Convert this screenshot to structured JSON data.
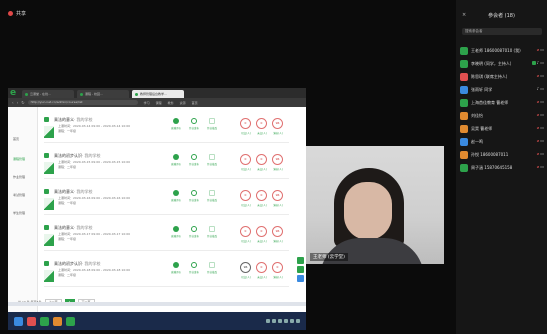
{
  "share": {
    "label": "共享"
  },
  "browser": {
    "tabs": [
      {
        "label": "云课堂 - 在线...",
        "active": false
      },
      {
        "label": "课程 - 校园...",
        "active": false
      },
      {
        "label": "教师管理后台教学...",
        "active": true
      }
    ],
    "url": "http://yun.net.cn/admin/course/list",
    "bookmarks": [
      "学习",
      "课程",
      "教务",
      "资源",
      "首页"
    ]
  },
  "sidenav": {
    "items": [
      {
        "label": "首页",
        "active": false
      },
      {
        "label": "课程管理",
        "active": true
      },
      {
        "label": "作业管理",
        "active": false
      },
      {
        "label": "考试管理",
        "active": false
      },
      {
        "label": "学生管理",
        "active": false
      }
    ]
  },
  "courses": [
    {
      "title": "乘法的意义",
      "subtitle": "· 我的学校",
      "time": "上课时间：2020-03-14 09:00 - 2020-03-14 10:00",
      "note": "课程：一年级",
      "actions": [
        "直播评价",
        "作业发布",
        "作业批改"
      ],
      "stats": [
        "0",
        "0",
        "96"
      ],
      "stat_labels": [
        "已交(人)",
        "未交(人)",
        "满分(人)"
      ]
    },
    {
      "title": "乘法的初步认识",
      "subtitle": "· 我的学校",
      "time": "上课时间：2020-03-15 09:00 - 2020-03-15 10:00",
      "note": "课程：二年级",
      "actions": [
        "直播评价",
        "作业发布",
        "作业批改"
      ],
      "stats": [
        "0",
        "0",
        "96"
      ],
      "stat_labels": [
        "已交(人)",
        "未交(人)",
        "满分(人)"
      ]
    },
    {
      "title": "乘法的意义",
      "subtitle": "· 我的学校",
      "time": "上课时间：2020-03-16 09:00 - 2020-03-16 10:00",
      "note": "课程：一年级",
      "actions": [
        "直播评价",
        "作业发布",
        "作业批改"
      ],
      "stats": [
        "0",
        "0",
        "96"
      ],
      "stat_labels": [
        "已交(人)",
        "未交(人)",
        "满分(人)"
      ]
    },
    {
      "title": "乘法的意义",
      "subtitle": "· 我的学校",
      "time": "上课时间：2020-03-17 09:00 - 2020-03-17 10:00",
      "note": "课程：一年级",
      "actions": [
        "直播评价",
        "作业发布",
        "作业批改"
      ],
      "stats": [
        "0",
        "0",
        "96"
      ],
      "stat_labels": [
        "已交(人)",
        "未交(人)",
        "满分(人)"
      ]
    },
    {
      "title": "乘法的初步认识",
      "subtitle": "· 我的学校",
      "time": "上课时间：2020-03-18 09:00 - 2020-03-18 10:00",
      "note": "课程：二年级",
      "actions": [
        "直播评价",
        "作业发布",
        "作业批改"
      ],
      "stats": [
        "96",
        "0",
        "0"
      ],
      "stat_labels": [
        "已交(人)",
        "未交(人)",
        "满分(人)"
      ]
    }
  ],
  "pager": {
    "summary": "共 10 条 每页5条",
    "prev": "上一页",
    "current": "1",
    "next": "下一页"
  },
  "video": {
    "name": "王老师 (云学堂)"
  },
  "panel": {
    "title": "参会者 (18)",
    "close": "×",
    "search": "搜索参会者",
    "participants": [
      {
        "name": "王老师 18600087010 (我)",
        "color": "#2da24b",
        "mic_off": true,
        "cam_off": true
      },
      {
        "name": "李晓明 (同学，主持人)",
        "color": "#2da24b",
        "mic_off": false,
        "cam_off": false,
        "tag": true
      },
      {
        "name": "陈思琪 (联席主持人)",
        "color": "#e05050",
        "mic_off": true,
        "cam_off": true
      },
      {
        "name": "张雨轩 同学",
        "color": "#3a8ae0",
        "mic_off": false,
        "cam_off": false
      },
      {
        "name": "上海首佳教育 曹老师",
        "color": "#2da24b",
        "mic_off": true,
        "cam_off": true
      },
      {
        "name": "刘佳怡",
        "color": "#e08a30",
        "mic_off": true,
        "cam_off": true
      },
      {
        "name": "吴昊 曹老师",
        "color": "#e08a30",
        "mic_off": true,
        "cam_off": true
      },
      {
        "name": "赵一鸣",
        "color": "#3a8ae0",
        "mic_off": true,
        "cam_off": true
      },
      {
        "name": "孙悦 18600087011",
        "color": "#e08a30",
        "mic_off": true,
        "cam_off": true
      },
      {
        "name": "周子涵 15870645158",
        "color": "#2da24b",
        "mic_off": true,
        "cam_off": true
      }
    ]
  }
}
